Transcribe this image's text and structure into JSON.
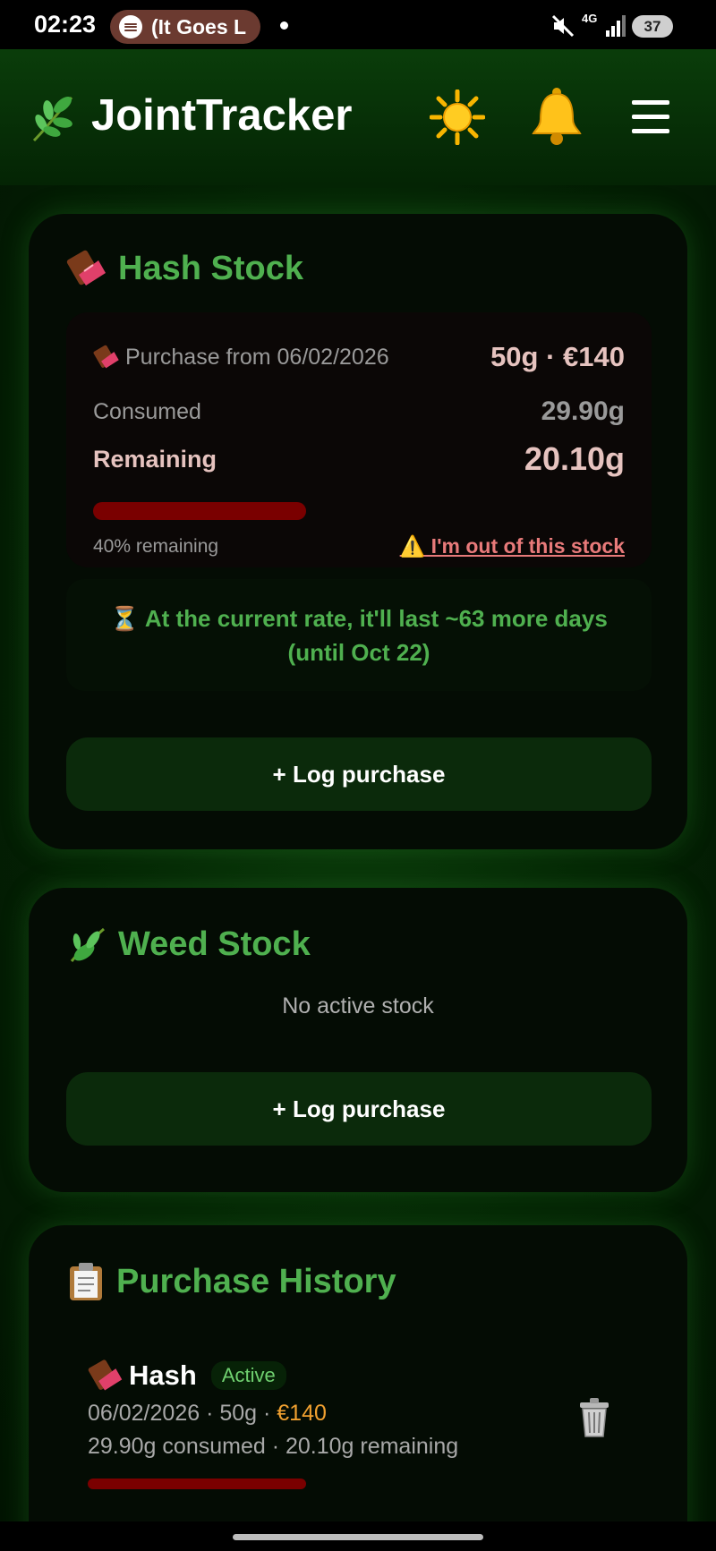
{
  "status_bar": {
    "time": "02:23",
    "media_pill": "(It Goes L",
    "network": "4G",
    "battery": "37"
  },
  "app": {
    "title": "JointTracker",
    "icons": [
      "herb-icon",
      "sun-icon",
      "bell-icon",
      "menu-icon"
    ]
  },
  "hash_card": {
    "title": "Hash Stock",
    "purchase_label": "Purchase from 06/02/2026",
    "purchase_summary": "50g · €140",
    "consumed_label": "Consumed",
    "consumed_value": "29.90g",
    "remaining_label": "Remaining",
    "remaining_value": "20.10g",
    "remaining_fraction": 0.4,
    "remaining_pct_text": "40% remaining",
    "out_of_stock_link": "⚠️ I'm out of this stock",
    "rate_line1": "⏳ At the current rate, it'll last ~63 more days",
    "rate_line2": "(until Oct 22)",
    "log_button": "+ Log purchase"
  },
  "weed_card": {
    "title": "Weed Stock",
    "empty_text": "No active stock",
    "log_button": "+ Log purchase"
  },
  "history_card": {
    "title": "Purchase History",
    "items": [
      {
        "type": "Hash",
        "badge": "Active",
        "date_qty": "06/02/2026 · 50g · ",
        "price": "€140",
        "usage": "29.90g consumed · 20.10g remaining",
        "remaining_fraction": 0.4
      }
    ]
  },
  "colors": {
    "accent_green": "#4fb04f",
    "price_orange": "#f0a030",
    "bar_red": "#7a0000",
    "warning_link": "#e87a7a"
  }
}
